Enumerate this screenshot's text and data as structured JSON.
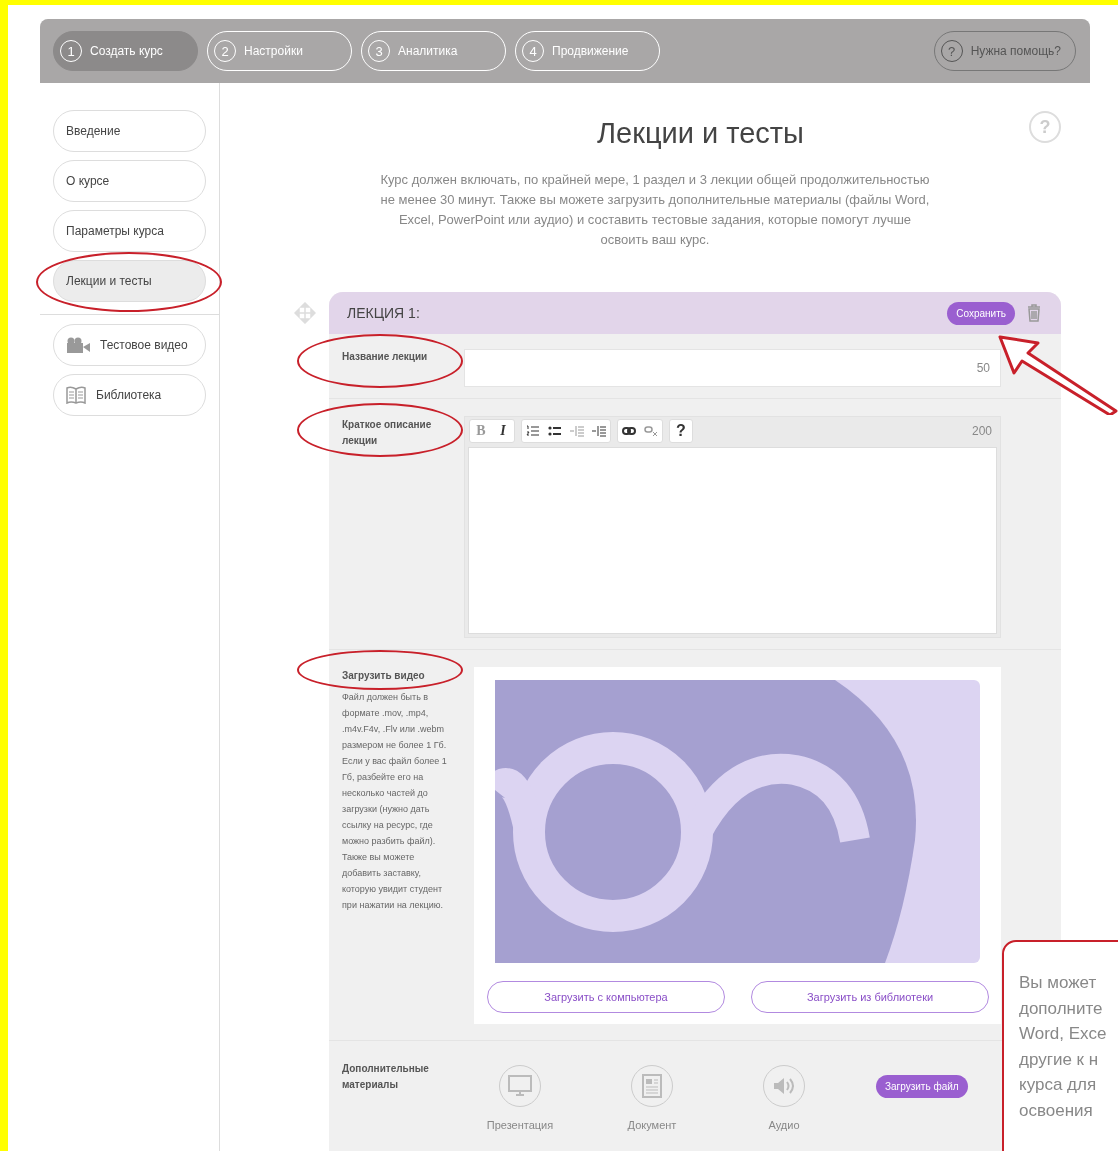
{
  "steps": [
    {
      "number": "1",
      "label": "Создать курс",
      "selected": true
    },
    {
      "number": "2",
      "label": "Настройки",
      "selected": false
    },
    {
      "number": "3",
      "label": "Аналитика",
      "selected": false
    },
    {
      "number": "4",
      "label": "Продвижение",
      "selected": false
    }
  ],
  "help_button": {
    "icon": "?",
    "label": "Нужна помощь?"
  },
  "sidebar": {
    "sections": [
      {
        "items": [
          {
            "label": "Введение",
            "kind": "plain",
            "selected": false,
            "circled": false
          },
          {
            "label": "О курсе",
            "kind": "plain",
            "selected": false,
            "circled": false
          },
          {
            "label": "Параметры курса",
            "kind": "plain",
            "selected": false,
            "circled": false
          },
          {
            "label": "Лекции и тесты",
            "kind": "plain",
            "selected": true,
            "circled": true
          }
        ]
      },
      {
        "items": [
          {
            "label": "Тестовое видео",
            "kind": "video",
            "selected": false,
            "circled": false
          },
          {
            "label": "Библиотека",
            "kind": "book",
            "selected": false,
            "circled": false
          }
        ]
      }
    ]
  },
  "page": {
    "title": "Лекции и тесты",
    "help_icon": "?",
    "description": "Курс должен включать, по крайней мере, 1 раздел и 3 лекции общей продолжительностью не менее 30 минут. Также вы можете загрузить дополнительные материалы (файлы Word, Excel, PowerPoint или аудио) и составить тестовые задания, которые помогут лучше освоить ваш курс."
  },
  "lecture": {
    "title": "ЛЕКЦИЯ 1:",
    "save_button": {
      "label": "Сохранить",
      "arrow": true
    },
    "name_field": {
      "label": "Название лекции",
      "counter": "50",
      "circled": true
    },
    "description_field": {
      "label": "Краткое описание лекции",
      "counter": "200",
      "circled": true,
      "toolbar": [
        [
          {
            "kind": "bold",
            "label": "B",
            "disabled": true
          },
          {
            "kind": "italic",
            "label": "I",
            "disabled": false
          }
        ],
        [
          {
            "kind": "ordered-list",
            "disabled": false
          },
          {
            "kind": "bullet-list",
            "disabled": false
          },
          {
            "kind": "outdent",
            "disabled": true
          },
          {
            "kind": "indent",
            "disabled": false
          }
        ],
        [
          {
            "kind": "link",
            "disabled": false
          },
          {
            "kind": "unlink",
            "disabled": true
          }
        ],
        [
          {
            "kind": "help",
            "label": "?",
            "disabled": false
          }
        ]
      ]
    },
    "video": {
      "label": "Загрузить видео",
      "hint": "Файл должен быть в формате .mov, .mp4, .m4v.F4v, .Flv или .webm размером не более 1 Гб. Если у вас файл более 1 Гб, разбейте его на несколько частей до загрузки (нужно дать ссылку на ресурс, где можно разбить файл). Также вы можете добавить заставку, которую увидит студент при нажатии на лекцию.",
      "circled": true,
      "buttons": [
        "Загрузить с компьютера",
        "Загрузить из библиотеки"
      ]
    },
    "materials": {
      "label": "Дополнительные материалы",
      "items": [
        {
          "kind": "presentation",
          "label": "Презентация"
        },
        {
          "kind": "document",
          "label": "Документ"
        },
        {
          "kind": "audio",
          "label": "Аудио"
        }
      ],
      "upload_button": "Загрузить файл"
    }
  },
  "callout": {
    "text": "Вы может\nдополните\nWord, Exce\nдругие к н\nкурса для\nосвоения"
  }
}
